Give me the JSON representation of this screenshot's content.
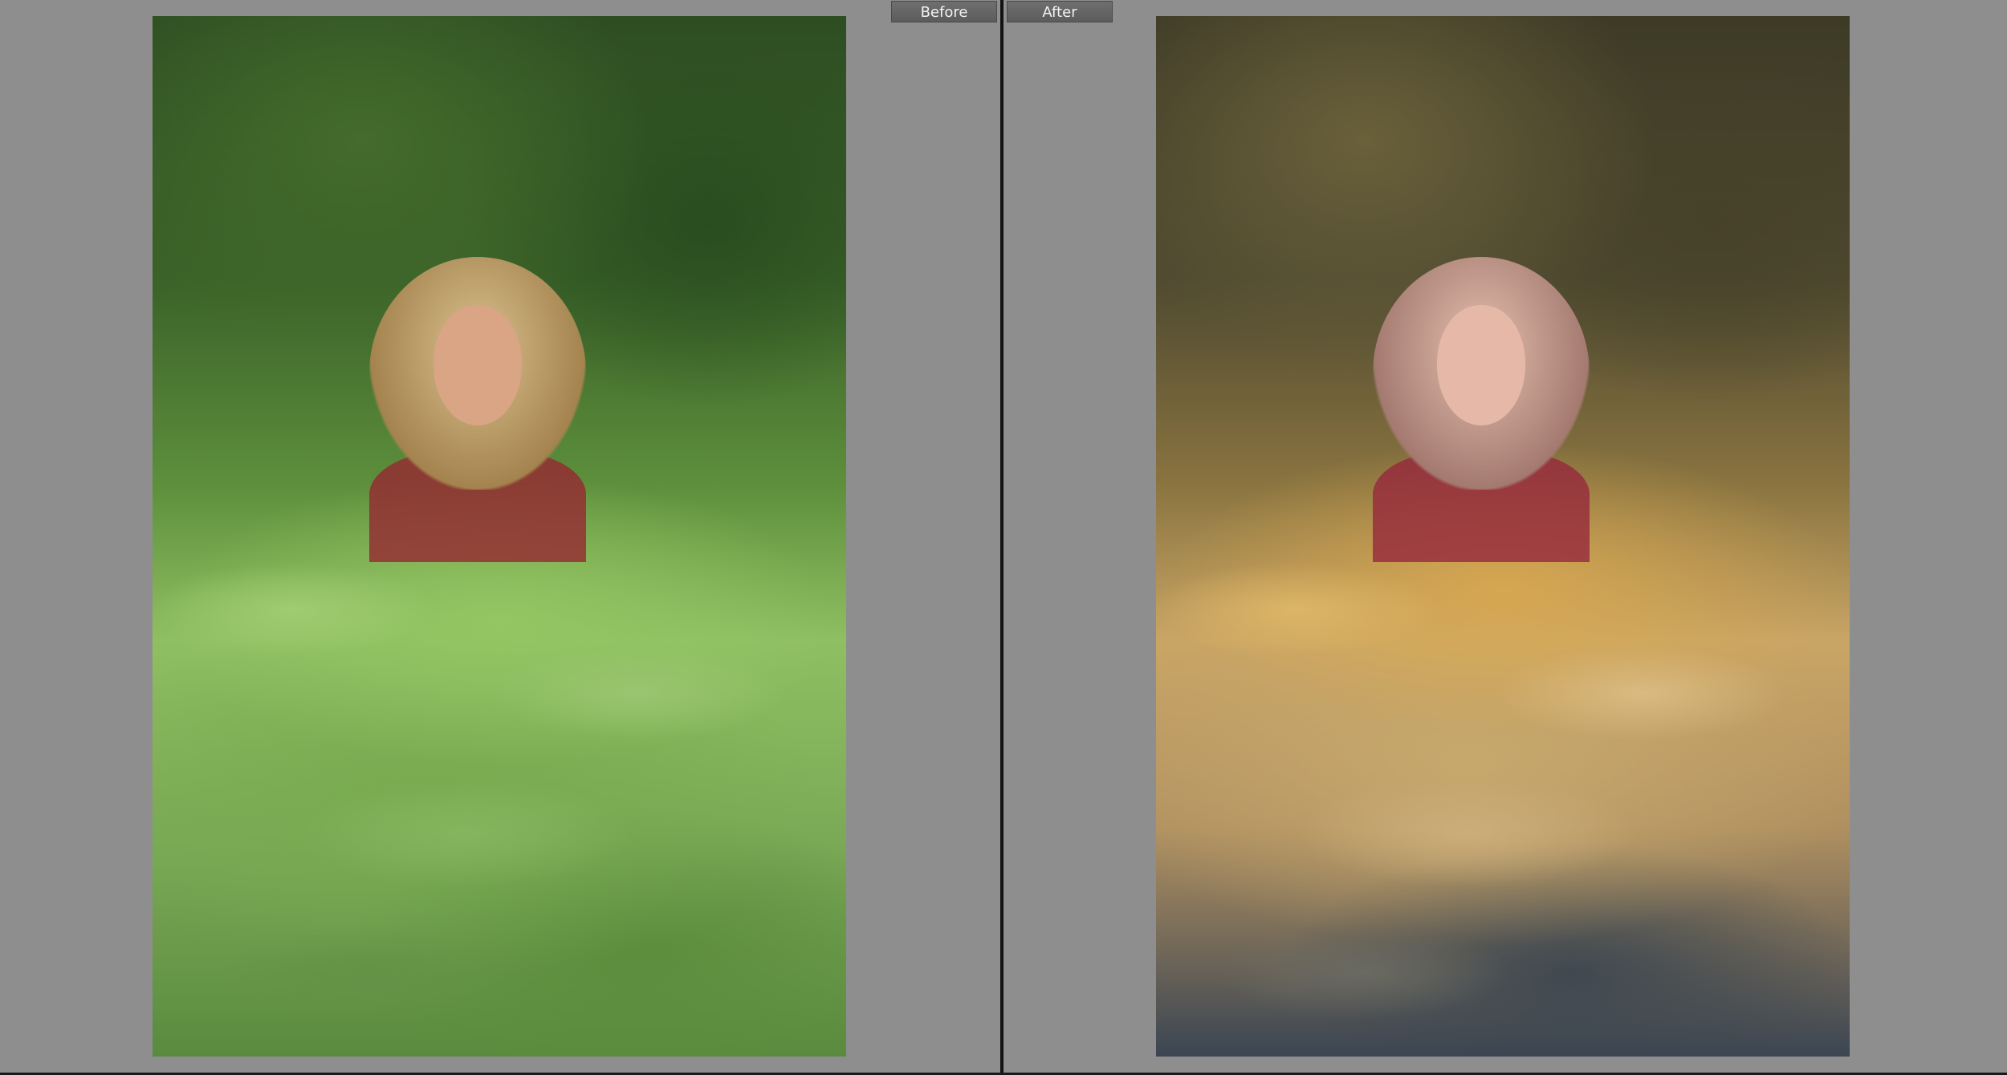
{
  "compare_view": {
    "before_label": "Before",
    "after_label": "After"
  },
  "colors": {
    "background": "#8f8f8f",
    "divider": "#121212",
    "label_bg": "#636363",
    "label_text": "#f2f2f2"
  }
}
